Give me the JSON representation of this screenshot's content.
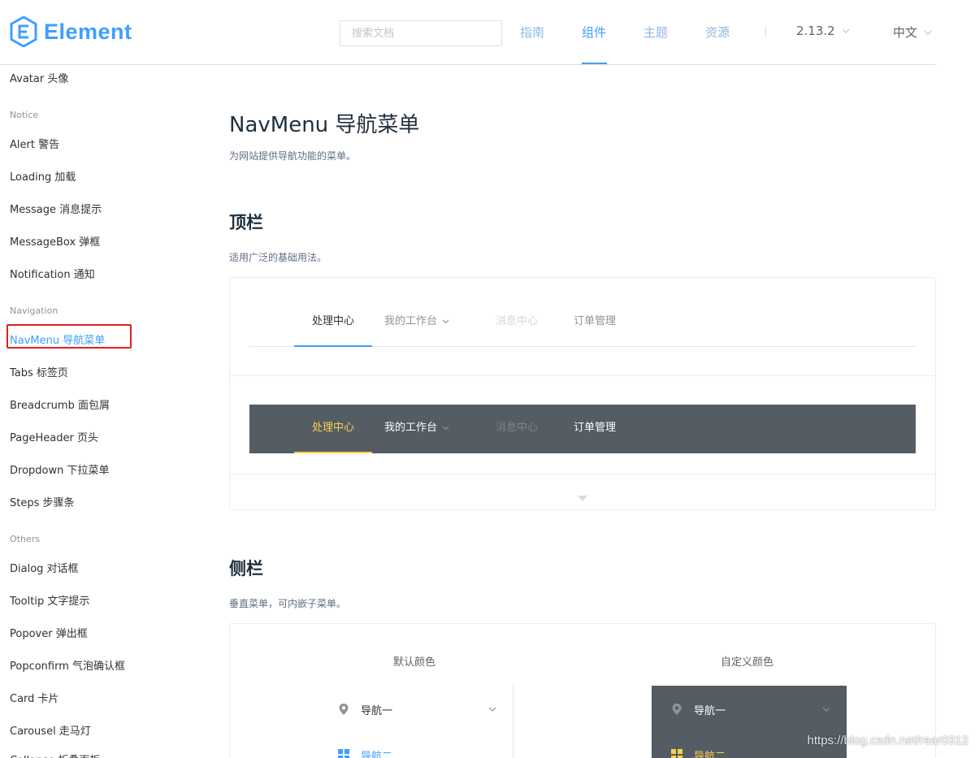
{
  "header": {
    "logo_text": "Element",
    "search_placeholder": "搜索文档",
    "nav": [
      "指南",
      "组件",
      "主题",
      "资源"
    ],
    "version": "2.13.2",
    "language": "中文"
  },
  "sidebar": {
    "items": [
      {
        "type": "item",
        "label": "Avatar 头像"
      },
      {
        "type": "group",
        "label": "Notice"
      },
      {
        "type": "item",
        "label": "Alert 警告"
      },
      {
        "type": "item",
        "label": "Loading 加载"
      },
      {
        "type": "item",
        "label": "Message 消息提示"
      },
      {
        "type": "item",
        "label": "MessageBox 弹框"
      },
      {
        "type": "item",
        "label": "Notification 通知"
      },
      {
        "type": "group",
        "label": "Navigation"
      },
      {
        "type": "item",
        "label": "NavMenu 导航菜单",
        "active": true
      },
      {
        "type": "item",
        "label": "Tabs 标签页"
      },
      {
        "type": "item",
        "label": "Breadcrumb 面包屑"
      },
      {
        "type": "item",
        "label": "PageHeader 页头"
      },
      {
        "type": "item",
        "label": "Dropdown 下拉菜单"
      },
      {
        "type": "item",
        "label": "Steps 步骤条"
      },
      {
        "type": "group",
        "label": "Others"
      },
      {
        "type": "item",
        "label": "Dialog 对话框"
      },
      {
        "type": "item",
        "label": "Tooltip 文字提示"
      },
      {
        "type": "item",
        "label": "Popover 弹出框"
      },
      {
        "type": "item",
        "label": "Popconfirm 气泡确认框"
      },
      {
        "type": "item",
        "label": "Card 卡片"
      },
      {
        "type": "item",
        "label": "Carousel 走马灯"
      },
      {
        "type": "item",
        "label": "Collapse 折叠面板"
      }
    ]
  },
  "main": {
    "title": "NavMenu 导航菜单",
    "description": "为网站提供导航功能的菜单。",
    "section_top": {
      "title": "顶栏",
      "description": "适用广泛的基础用法。",
      "menu_items": [
        "处理中心",
        "我的工作台",
        "消息中心",
        "订单管理"
      ]
    },
    "section_side": {
      "title": "侧栏",
      "description": "垂直菜单，可内嵌子菜单。",
      "default_color_label": "默认颜色",
      "custom_color_label": "自定义颜色",
      "nav_one": "导航一",
      "nav_two": "导航二"
    }
  },
  "colors": {
    "primary": "#409eff",
    "dark_menu_bg": "#545c64",
    "dark_active": "#ffd04b",
    "highlight_border": "#e02020"
  },
  "watermark": "https://blog.csdn.net/rear0312"
}
